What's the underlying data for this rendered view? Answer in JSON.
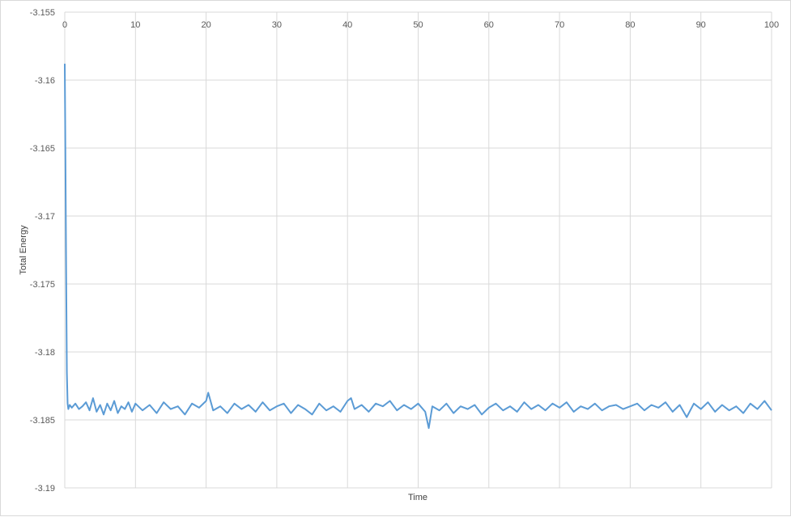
{
  "chart_data": {
    "type": "line",
    "title": "",
    "xlabel": "Time",
    "ylabel": "Total Energy",
    "xlim": [
      0,
      100
    ],
    "ylim": [
      -3.19,
      -3.155
    ],
    "x_ticks": [
      0,
      10,
      20,
      30,
      40,
      50,
      60,
      70,
      80,
      90,
      100
    ],
    "x_tick_labels": [
      "0",
      "10",
      "20",
      "30",
      "40",
      "50",
      "60",
      "70",
      "80",
      "90",
      "100"
    ],
    "y_ticks": [
      -3.155,
      -3.16,
      -3.165,
      -3.17,
      -3.175,
      -3.18,
      -3.185,
      -3.19
    ],
    "y_tick_labels": [
      "-3.155",
      "-3.16",
      "-3.165",
      "-3.17",
      "-3.175",
      "-3.18",
      "-3.185",
      "-3.19"
    ],
    "x_axis_position": "top",
    "grid": true,
    "legend": false,
    "series": [
      {
        "color": "#5b9bd5",
        "x": [
          0,
          0.1,
          0.2,
          0.3,
          0.4,
          0.5,
          0.7,
          1,
          1.5,
          2,
          2.5,
          3,
          3.5,
          4,
          4.5,
          5,
          5.5,
          6,
          6.5,
          7,
          7.5,
          8,
          8.5,
          9,
          9.5,
          10,
          11,
          12,
          13,
          14,
          15,
          16,
          17,
          18,
          19,
          20,
          20.3,
          21,
          22,
          23,
          24,
          25,
          26,
          27,
          28,
          29,
          30,
          31,
          32,
          33,
          34,
          35,
          36,
          37,
          38,
          39,
          40,
          40.5,
          41,
          42,
          43,
          44,
          45,
          46,
          47,
          48,
          49,
          50,
          51,
          51.5,
          52,
          53,
          54,
          55,
          56,
          57,
          58,
          59,
          60,
          61,
          62,
          63,
          64,
          65,
          66,
          67,
          68,
          69,
          70,
          71,
          72,
          73,
          74,
          75,
          76,
          77,
          78,
          79,
          80,
          81,
          82,
          83,
          84,
          85,
          86,
          87,
          88,
          89,
          90,
          91,
          92,
          93,
          94,
          95,
          96,
          97,
          98,
          99,
          100
        ],
        "values": [
          -3.1588,
          -3.1665,
          -3.174,
          -3.1815,
          -3.1838,
          -3.1842,
          -3.1839,
          -3.1841,
          -3.1838,
          -3.1842,
          -3.184,
          -3.1837,
          -3.1843,
          -3.1834,
          -3.1844,
          -3.1839,
          -3.1846,
          -3.1838,
          -3.1843,
          -3.1836,
          -3.1845,
          -3.184,
          -3.1842,
          -3.1837,
          -3.1844,
          -3.1838,
          -3.1843,
          -3.1839,
          -3.1845,
          -3.1837,
          -3.1842,
          -3.184,
          -3.1846,
          -3.1838,
          -3.1841,
          -3.1836,
          -3.183,
          -3.1843,
          -3.184,
          -3.1845,
          -3.1838,
          -3.1842,
          -3.1839,
          -3.1844,
          -3.1837,
          -3.1843,
          -3.184,
          -3.1838,
          -3.1845,
          -3.1839,
          -3.1842,
          -3.1846,
          -3.1838,
          -3.1843,
          -3.184,
          -3.1844,
          -3.1836,
          -3.1834,
          -3.1842,
          -3.1839,
          -3.1844,
          -3.1838,
          -3.184,
          -3.1836,
          -3.1843,
          -3.1839,
          -3.1842,
          -3.1838,
          -3.1844,
          -3.1856,
          -3.184,
          -3.1843,
          -3.1838,
          -3.1845,
          -3.184,
          -3.1842,
          -3.1839,
          -3.1846,
          -3.1841,
          -3.1838,
          -3.1843,
          -3.184,
          -3.1844,
          -3.1837,
          -3.1842,
          -3.1839,
          -3.1843,
          -3.1838,
          -3.1841,
          -3.1837,
          -3.1844,
          -3.184,
          -3.1842,
          -3.1838,
          -3.1843,
          -3.184,
          -3.1839,
          -3.1842,
          -3.184,
          -3.1838,
          -3.1843,
          -3.1839,
          -3.1841,
          -3.1837,
          -3.1844,
          -3.1839,
          -3.1848,
          -3.1838,
          -3.1842,
          -3.1837,
          -3.1844,
          -3.1839,
          -3.1843,
          -3.184,
          -3.1845,
          -3.1838,
          -3.1842,
          -3.1836,
          -3.1843
        ]
      }
    ]
  }
}
